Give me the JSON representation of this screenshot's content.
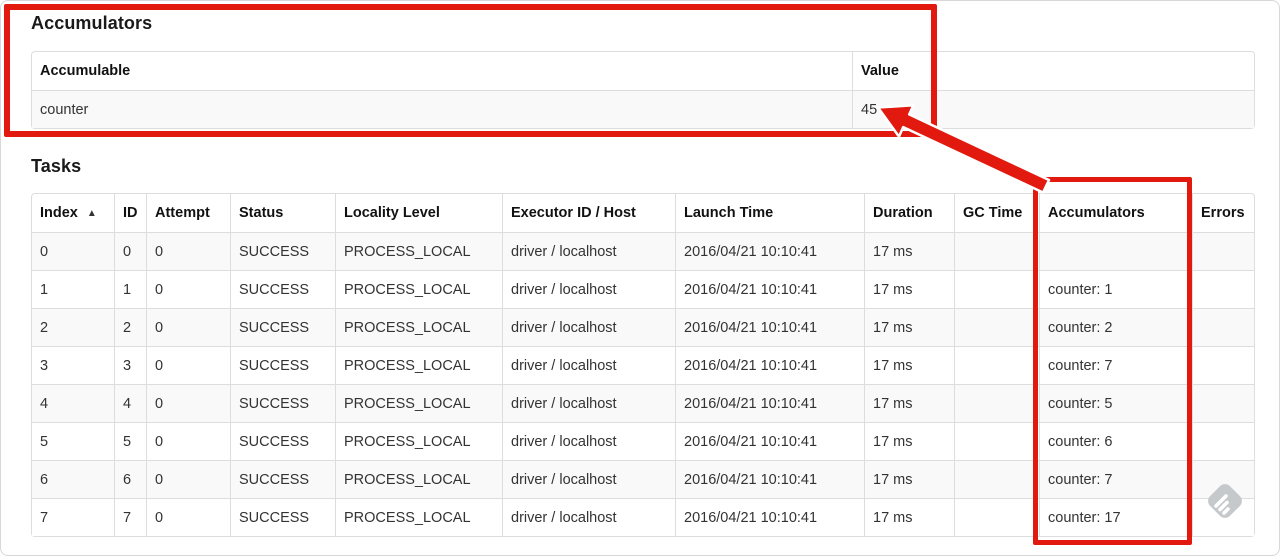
{
  "annotations": {
    "color": "#e2190f",
    "arrow_outline": "#ffffff"
  },
  "icons": {
    "sort_ascending": "▲"
  },
  "accumulators_section": {
    "title": "Accumulators",
    "headers": {
      "accumulable": "Accumulable",
      "value": "Value"
    },
    "row": {
      "accumulable": "counter",
      "value": "45"
    }
  },
  "tasks_section": {
    "title": "Tasks",
    "headers": {
      "index": "Index",
      "id": "ID",
      "attempt": "Attempt",
      "status": "Status",
      "locality": "Locality Level",
      "executor": "Executor ID / Host",
      "launch": "Launch Time",
      "duration": "Duration",
      "gc_time": "GC Time",
      "accumulators": "Accumulators",
      "errors": "Errors"
    },
    "rows": [
      [
        "0",
        "0",
        "0",
        "SUCCESS",
        "PROCESS_LOCAL",
        "driver / localhost",
        "2016/04/21 10:10:41",
        "17 ms",
        "",
        "",
        ""
      ],
      [
        "1",
        "1",
        "0",
        "SUCCESS",
        "PROCESS_LOCAL",
        "driver / localhost",
        "2016/04/21 10:10:41",
        "17 ms",
        "",
        "counter: 1",
        ""
      ],
      [
        "2",
        "2",
        "0",
        "SUCCESS",
        "PROCESS_LOCAL",
        "driver / localhost",
        "2016/04/21 10:10:41",
        "17 ms",
        "",
        "counter: 2",
        ""
      ],
      [
        "3",
        "3",
        "0",
        "SUCCESS",
        "PROCESS_LOCAL",
        "driver / localhost",
        "2016/04/21 10:10:41",
        "17 ms",
        "",
        "counter: 7",
        ""
      ],
      [
        "4",
        "4",
        "0",
        "SUCCESS",
        "PROCESS_LOCAL",
        "driver / localhost",
        "2016/04/21 10:10:41",
        "17 ms",
        "",
        "counter: 5",
        ""
      ],
      [
        "5",
        "5",
        "0",
        "SUCCESS",
        "PROCESS_LOCAL",
        "driver / localhost",
        "2016/04/21 10:10:41",
        "17 ms",
        "",
        "counter: 6",
        ""
      ],
      [
        "6",
        "6",
        "0",
        "SUCCESS",
        "PROCESS_LOCAL",
        "driver / localhost",
        "2016/04/21 10:10:41",
        "17 ms",
        "",
        "counter: 7",
        ""
      ],
      [
        "7",
        "7",
        "0",
        "SUCCESS",
        "PROCESS_LOCAL",
        "driver / localhost",
        "2016/04/21 10:10:41",
        "17 ms",
        "",
        "counter: 17",
        ""
      ]
    ]
  }
}
